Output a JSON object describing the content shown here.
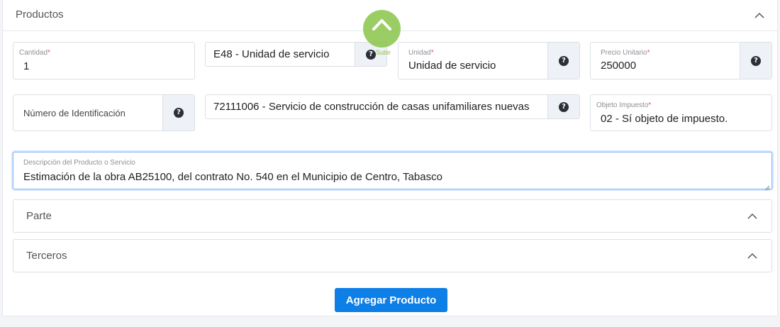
{
  "section": {
    "title": "Productos"
  },
  "fields": {
    "cantidad": {
      "label": "Cantidad",
      "value": "1"
    },
    "clave_unidad": {
      "value": "E48 - Unidad de servicio"
    },
    "unidad": {
      "label": "Unidad",
      "value": "Unidad de servicio"
    },
    "precio_unitario": {
      "label": "Precio Unitario",
      "value": "250000"
    },
    "numero_identificacion": {
      "placeholder": "Número de Identificación"
    },
    "clave_producto": {
      "value": "72111006 - Servicio de construcción de casas unifamiliares nuevas"
    },
    "objeto_impuesto": {
      "label": "Objeto Impuesto",
      "value": "02 - Sí objeto de impuesto."
    },
    "descripcion": {
      "label": "Descripción del Producto o Servicio",
      "value": "Estimación de la obra AB25100, del contrato No. 540 en el Municipio de Centro, Tabasco"
    }
  },
  "required_mark": "*",
  "help_glyph": "?",
  "panels": [
    {
      "title": "Parte"
    },
    {
      "title": "Terceros"
    }
  ],
  "actions": {
    "add_product": "Agregar Producto"
  },
  "scroll_top": {
    "label": "Subir"
  },
  "colors": {
    "primary": "#0d7fe6",
    "required": "#e8505b",
    "scroll_top": "#89c44a"
  }
}
